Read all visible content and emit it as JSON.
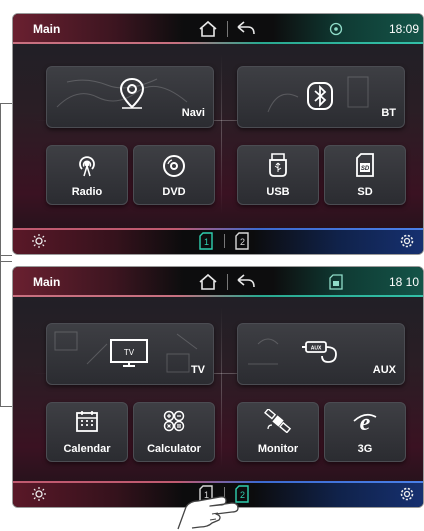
{
  "screen1": {
    "title": "Main",
    "time": "18:09",
    "tiles": {
      "navi": "Navi",
      "bt": "BT",
      "radio": "Radio",
      "dvd": "DVD",
      "usb": "USB",
      "sd": "SD"
    },
    "active_page": 1
  },
  "screen2": {
    "title": "Main",
    "time": "18 10",
    "tiles": {
      "tv": "TV",
      "aux": "AUX",
      "tv_screen_text": "TV",
      "aux_plug_text": "AUX",
      "calendar": "Calendar",
      "calculator": "Calculator",
      "monitor": "Monitor",
      "g3": "3G"
    },
    "active_page": 2
  },
  "pagination": {
    "page1": "1",
    "page2": "2"
  },
  "colors": {
    "accent_red": "#c87080",
    "accent_green": "#2aa890",
    "accent_blue": "#4a80e8",
    "active_page": "#2fd0b0"
  }
}
